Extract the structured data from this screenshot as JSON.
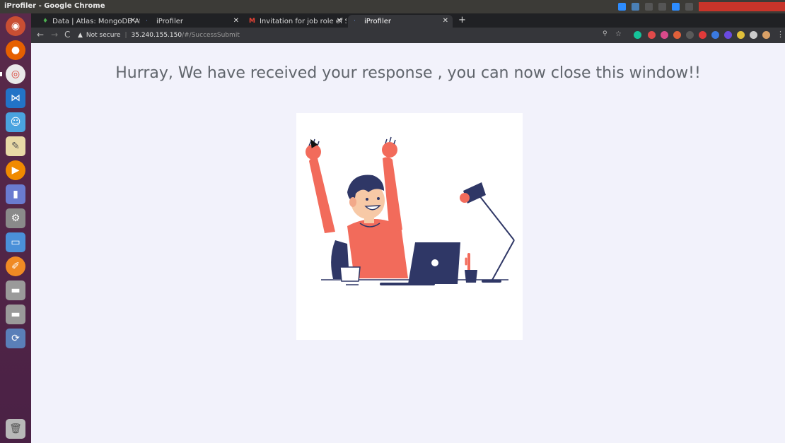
{
  "window": {
    "title": "iProfiler - Google Chrome"
  },
  "tabs": [
    {
      "label": "Data | Atlas: MongoDB At",
      "favicon": "leaf-icon",
      "active": false
    },
    {
      "label": "iProfiler",
      "favicon": "iprofiler-icon",
      "active": false
    },
    {
      "label": "Invitation for job role of S",
      "favicon": "gmail-icon",
      "active": false
    },
    {
      "label": "iProfiler",
      "favicon": "iprofiler-icon",
      "active": true
    }
  ],
  "addressbar": {
    "security": "Not secure",
    "host": "35.240.155.150",
    "path": "/#/SuccessSubmit"
  },
  "page": {
    "heading": "Hurray, We have received your response , you can now close this window!!"
  },
  "colors": {
    "page_bg": "#f2f2fb",
    "heading": "#5f646b",
    "shirt": "#f26b5b",
    "navy": "#2f3766"
  }
}
